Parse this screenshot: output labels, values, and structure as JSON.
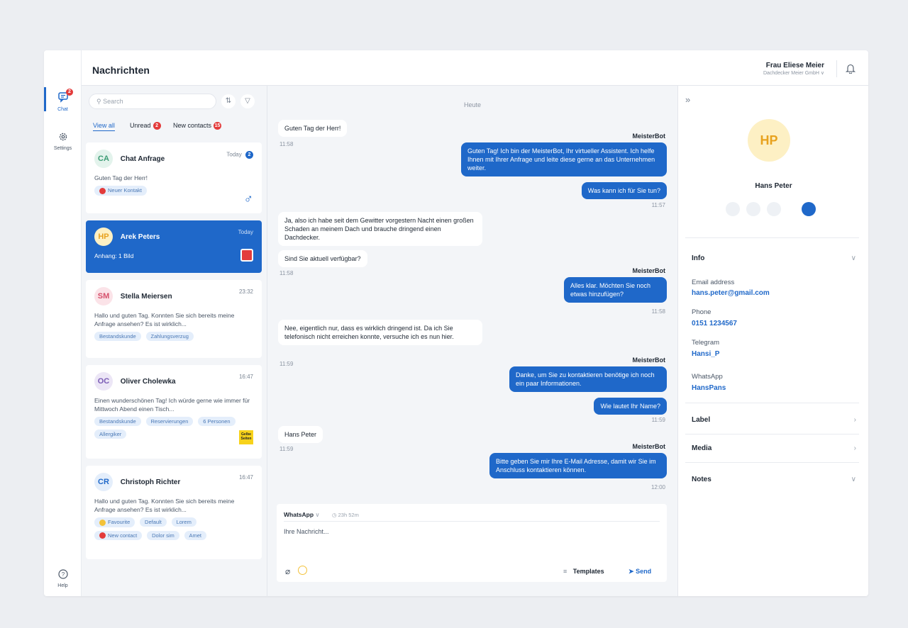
{
  "header": {
    "title": "Nachrichten",
    "user_name": "Frau Eliese Meier",
    "user_company": "Dachdecker Meier GmbH"
  },
  "nav": {
    "chat_label": "Chat",
    "chat_badge": "2",
    "settings_label": "Settings",
    "help_label": "Help"
  },
  "list": {
    "search_placeholder": "Search",
    "tabs": {
      "all": "View all",
      "unread": "Unread",
      "unread_count": "2",
      "new_contacts": "New contacts",
      "new_contacts_count": "15"
    },
    "cards": [
      {
        "initials": "CA",
        "name": "Chat Anfrage",
        "time": "Today",
        "unread": "2",
        "message": "Guten Tag der Herr!",
        "chips": [
          "Neuer Kontakt"
        ]
      },
      {
        "initials": "HP",
        "name": "Arek Peters",
        "time": "Today",
        "message": "Anhang: 1 Bild"
      },
      {
        "initials": "SM",
        "name": "Stella Meiersen",
        "time": "23:32",
        "message": "Hallo und guten Tag. Konnten Sie sich bereits meine Anfrage ansehen? Es ist wirklich...",
        "chips": [
          "Bestandskunde",
          "Zahlungsverzug"
        ]
      },
      {
        "initials": "OC",
        "name": "Oliver Cholewka",
        "time": "16:47",
        "message": "Einen wunderschönen Tag! Ich würde gerne wie immer für Mittwoch Abend einen Tisch...",
        "chips": [
          "Bestandskunde",
          "Reservierungen",
          "6 Personen",
          "Allergiker"
        ],
        "brand": "Gelbe Seiten"
      },
      {
        "initials": "CR",
        "name": "Christoph Richter",
        "time": "16:47",
        "message": "Hallo und guten Tag. Konnten Sie sich bereits meine Anfrage ansehen? Es ist wirklich...",
        "chips": [
          "Favourite",
          "Default",
          "Lorem",
          "New contact",
          "Dolor sim",
          "Amet"
        ]
      }
    ]
  },
  "chat": {
    "day": "Heute",
    "messages": [
      {
        "text": "Guten Tag der Herr!",
        "time": "11:58"
      },
      {
        "sender": "MeisterBot",
        "text": "Guten Tag! Ich bin der MeisterBot, Ihr virtueller Assistent. Ich helfe Ihnen mit Ihrer Anfrage und leite diese gerne an das Unternehmen weiter."
      },
      {
        "text": "Was kann ich für Sie tun?",
        "time": "11:57"
      },
      {
        "text": "Ja, also ich habe seit dem Gewitter vorgestern Nacht einen großen Schaden an meinem Dach und brauche dringend einen Dachdecker."
      },
      {
        "text": "Sind Sie aktuell verfügbar?",
        "time": "11:58"
      },
      {
        "sender": "MeisterBot",
        "text": "Alles klar. Möchten Sie noch etwas hinzufügen?",
        "time": "11:58"
      },
      {
        "text": "Nee, eigentlich nur, dass es wirklich dringend ist. Da ich Sie telefonisch nicht erreichen konnte, versuche ich es nun hier.",
        "time": "11:59"
      },
      {
        "sender": "MeisterBot",
        "text": "Danke, um Sie zu kontaktieren benötige ich noch ein paar Informationen."
      },
      {
        "text": "Wie lautet Ihr Name?",
        "time": "11:59"
      },
      {
        "text": "Hans Peter",
        "time": "11:59"
      },
      {
        "sender": "MeisterBot",
        "text": "Bitte geben Sie mir Ihre E-Mail Adresse, damit wir Sie im Anschluss kontaktieren können.",
        "time": "12:00"
      }
    ],
    "composer": {
      "channel": "WhatsApp",
      "timer": "23h 52m",
      "placeholder": "Ihre Nachricht...",
      "templates": "Templates",
      "send": "Send"
    }
  },
  "contact": {
    "initials": "HP",
    "name": "Hans Peter",
    "info_title": "Info",
    "fields": [
      {
        "label": "Email address",
        "value": "hans.peter@gmail.com"
      },
      {
        "label": "Phone",
        "value": "0151 1234567"
      },
      {
        "label": "Telegram",
        "value": "Hansi_P"
      },
      {
        "label": "WhatsApp",
        "value": "HansPans"
      }
    ],
    "sections": [
      "Label",
      "Media",
      "Notes"
    ]
  }
}
